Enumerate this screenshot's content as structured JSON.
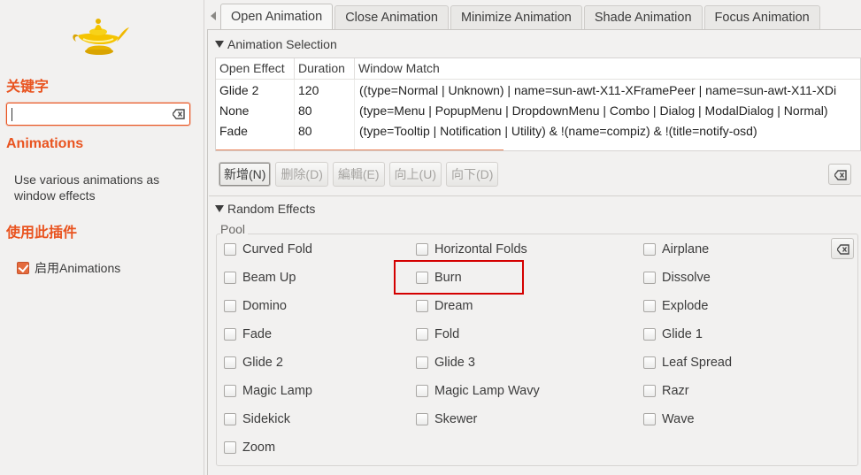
{
  "sidebar": {
    "keyword_heading": "关键字",
    "plugin_name": "Animations",
    "description": "Use various animations as window effects",
    "enable_heading": "使用此插件",
    "enable_label": "启用Animations",
    "accent_color": "#e95420"
  },
  "tabs": [
    "Open Animation",
    "Close Animation",
    "Minimize Animation",
    "Shade Animation",
    "Focus Animation"
  ],
  "animation_selection": {
    "title": "Animation Selection",
    "columns": [
      "Open Effect",
      "Duration",
      "Window Match"
    ],
    "rows": [
      {
        "effect": "Glide 2",
        "duration": "120",
        "match": "((type=Normal | Unknown) | name=sun-awt-X11-XFramePeer | name=sun-awt-X11-XDi"
      },
      {
        "effect": "None",
        "duration": "80",
        "match": "(type=Menu | PopupMenu | DropdownMenu | Combo | Dialog | ModalDialog | Normal)"
      },
      {
        "effect": "Fade",
        "duration": "80",
        "match": "(type=Tooltip | Notification | Utility) & !(name=compiz) & !(title=notify-osd)"
      }
    ],
    "buttons": [
      "新增(N)",
      "删除(D)",
      "編輯(E)",
      "向上(U)",
      "向下(D)"
    ]
  },
  "random_effects": {
    "title": "Random Effects",
    "pool_label": "Pool",
    "effects": [
      "Curved Fold",
      "Horizontal Folds",
      "Airplane",
      "Beam Up",
      "Burn",
      "Dissolve",
      "Domino",
      "Dream",
      "Explode",
      "Fade",
      "Fold",
      "Glide 1",
      "Glide 2",
      "Glide 3",
      "Leaf Spread",
      "Magic Lamp",
      "Magic Lamp Wavy",
      "Razr",
      "Sidekick",
      "Skewer",
      "Wave",
      "Zoom"
    ],
    "highlighted_effect": "Burn"
  }
}
